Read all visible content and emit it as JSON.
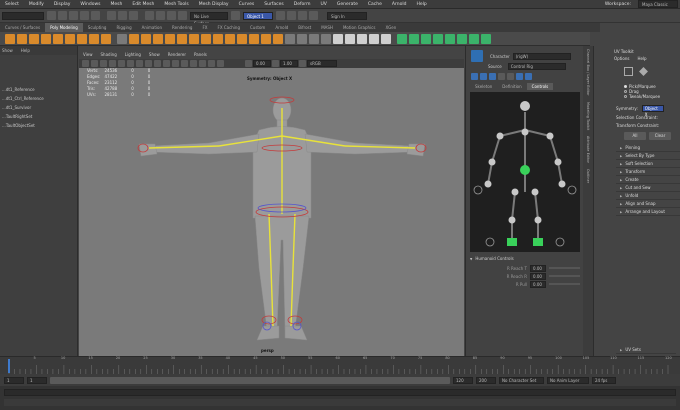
{
  "menubar": {
    "items": [
      "Select",
      "Modify",
      "Display",
      "Windows",
      "Mesh",
      "Edit Mesh",
      "Mesh Tools",
      "Mesh Display",
      "Curves",
      "Surfaces",
      "Deform",
      "UV",
      "Generate",
      "Cache",
      "Arnold",
      "Help"
    ],
    "workspace_label": "Workspace:",
    "workspace_value": "Maya Classic"
  },
  "statusline": {
    "live_surface": "No Live Surface",
    "object_field": "Object 1",
    "sign_in": "Sign In"
  },
  "shelf": {
    "tabs": [
      "Curves / Surfaces",
      "Poly Modeling",
      "Sculpting",
      "Rigging",
      "Animation",
      "Rendering",
      "FX",
      "FX Caching",
      "Custom",
      "Arnold",
      "Bifrost",
      "MASH",
      "Motion Graphics",
      "XGen"
    ],
    "active_tab": "Poly Modeling"
  },
  "outliner": {
    "menu": [
      "Show",
      "Help"
    ],
    "items": [
      "",
      "...dt1_Reference",
      "...dt1_Ctrl_Reference",
      "...dt1_Survivor",
      "...TaultRightSet",
      "...TaultObjectSet"
    ]
  },
  "viewport": {
    "menu": [
      "View",
      "Shading",
      "Lighting",
      "Show",
      "Renderer",
      "Panels"
    ],
    "exposure": "0.00",
    "gamma": "1.00",
    "colorspace": "sRGB gamma",
    "hud": [
      {
        "label": "Verts:",
        "v1": "24536",
        "v2": "0",
        "v3": "0"
      },
      {
        "label": "Edges:",
        "v1": "47422",
        "v2": "0",
        "v3": "0"
      },
      {
        "label": "Faces:",
        "v1": "23112",
        "v2": "0",
        "v3": "0"
      },
      {
        "label": "Tris:",
        "v1": "42788",
        "v2": "0",
        "v3": "0"
      },
      {
        "label": "UVs:",
        "v1": "28131",
        "v2": "0",
        "v3": "0"
      }
    ],
    "symmetry": "Symmetry: Object X",
    "camera": "persp"
  },
  "character_controls": {
    "character_label": "Character",
    "character_value": "(rigW)",
    "source_label": "Source",
    "source_value": "Control Rig",
    "tabs": [
      "Skeleton",
      "Definition",
      "Controls"
    ],
    "active_tab": "Controls",
    "section": "Humanoid Controls",
    "rows": [
      {
        "label": "R Reach T",
        "value": "0.00"
      },
      {
        "label": "R Reach R",
        "value": "0.00"
      },
      {
        "label": "R Pull",
        "value": "0.00"
      }
    ]
  },
  "side_tabs": [
    "Channel Box / Layer Editor",
    "Modeling Toolkit",
    "Attribute Editor",
    "Outliner"
  ],
  "toolkit": {
    "title": "UV Toolkit",
    "menu": [
      "Options",
      "Help"
    ],
    "radios": [
      "Pick/Marquee",
      "Drag",
      "Tweak/Marquee"
    ],
    "symmetry_label": "Symmetry:",
    "symmetry_value": "Object X",
    "selection_constraint": "Selection Constraint:",
    "transform_constraint": "Transform Constraint:",
    "all_button": "All",
    "clear_button": "Clear",
    "sections": [
      "Pinning",
      "Select By Type",
      "Soft Selection",
      "Transform",
      "Create",
      "Cut and Sew",
      "Unfold",
      "Align and Snap",
      "Arrange and Layout"
    ],
    "uv_sets": "UV Sets"
  },
  "timeline": {
    "ticks": [
      "5",
      "10",
      "15",
      "20",
      "25",
      "30",
      "35",
      "40",
      "45",
      "50",
      "55",
      "60",
      "65",
      "70",
      "75",
      "80",
      "85",
      "90",
      "95",
      "100",
      "105",
      "110",
      "115",
      "120"
    ],
    "current_frame": "1"
  },
  "range": {
    "start": "1",
    "inner_start": "1",
    "inner_end": "120",
    "end": "200",
    "character": "No Character Set",
    "anim_layer": "No Anim Layer",
    "fps": "24 fps"
  },
  "colors": {
    "accent": "#d98a2b",
    "joint_yellow": "#e8e23a",
    "ctrl_red": "#c43a3a",
    "rig_green": "#39d15a"
  }
}
